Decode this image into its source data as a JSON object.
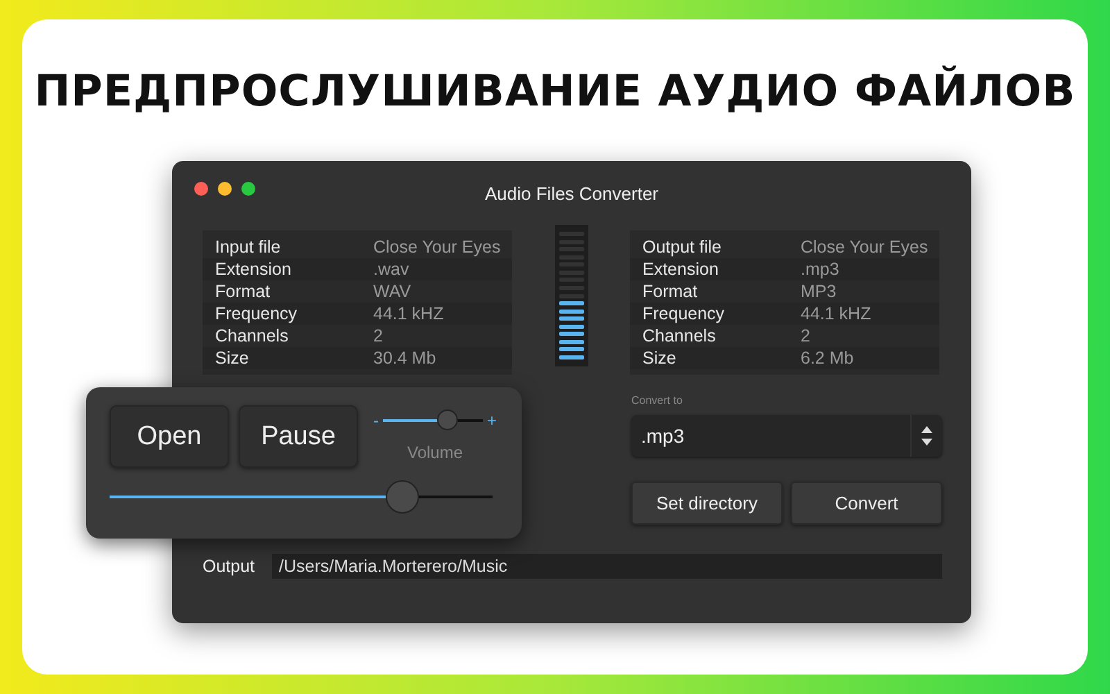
{
  "headline": "ПРЕДПРОСЛУШИВАНИЕ АУДИО ФАЙЛОВ",
  "window": {
    "title": "Audio Files Converter"
  },
  "input_table": [
    {
      "label": "Input file",
      "value": "Close Your Eyes"
    },
    {
      "label": "Extension",
      "value": ".wav"
    },
    {
      "label": "Format",
      "value": "WAV"
    },
    {
      "label": "Frequency",
      "value": "44.1 kHZ"
    },
    {
      "label": "Channels",
      "value": "2"
    },
    {
      "label": "Size",
      "value": "30.4 Mb"
    }
  ],
  "level_meter": {
    "level": 0.47
  },
  "output_table": [
    {
      "label": "Output file",
      "value": "Close Your Eyes"
    },
    {
      "label": "Extension",
      "value": ".mp3"
    },
    {
      "label": "Format",
      "value": "MP3"
    },
    {
      "label": "Frequency",
      "value": "44.1 kHZ"
    },
    {
      "label": "Channels",
      "value": "2"
    },
    {
      "label": "Size",
      "value": "6.2 Mb"
    }
  ],
  "convert_to": {
    "label": "Convert to",
    "value": ".mp3"
  },
  "action_buttons": [
    "Set directory",
    "Convert"
  ],
  "output": {
    "label": "Output",
    "value": "/Users/Maria.Morterero/Music"
  },
  "player": {
    "buttons": [
      "Open",
      "Pause"
    ],
    "volume": {
      "minus": "-",
      "plus": "+",
      "label": "Volume",
      "level": 0.68
    },
    "progress": {
      "level": 0.79
    }
  }
}
